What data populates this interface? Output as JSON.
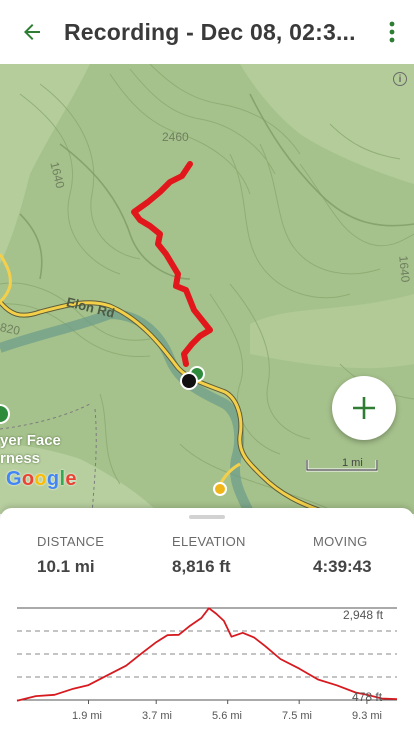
{
  "app_bar": {
    "title": "Recording - Dec 08, 02:3...",
    "back_icon": "arrow-back-icon",
    "menu_icon": "more-vertical-icon",
    "accent_color": "#2e7d32"
  },
  "map": {
    "contour_labels": [
      "2460",
      "1640",
      "1640",
      "820"
    ],
    "road_label": "Elon Rd",
    "place_label_line1": "yer Face",
    "place_label_line2": "rness",
    "google_logo": {
      "g": "G",
      "o1": "o",
      "o2": "o",
      "g2": "g",
      "l": "l",
      "e": "e"
    },
    "scale_label": "1 mi",
    "zoom_icon": "plus-icon",
    "info_icon": "info-icon",
    "route_color": "#e2171c"
  },
  "stats": {
    "distance": {
      "label": "DISTANCE",
      "value": "10.1 mi"
    },
    "elevation": {
      "label": "ELEVATION",
      "value": "8,816 ft"
    },
    "moving": {
      "label": "MOVING",
      "value": "4:39:43"
    }
  },
  "chart_data": {
    "type": "area",
    "title": "",
    "xlabel": "",
    "ylabel": "",
    "x_ticks": [
      "1.9 mi",
      "3.7 mi",
      "5.6 mi",
      "7.5 mi",
      "9.3 mi"
    ],
    "y_ticks": [
      "2,948 ft",
      "478 ft"
    ],
    "xlim": [
      0,
      10.1
    ],
    "ylim": [
      478,
      2948
    ],
    "grid": true,
    "series": [
      {
        "color": "#d61a1f",
        "x": [
          0,
          0.5,
          1.0,
          1.5,
          1.9,
          2.4,
          2.9,
          3.3,
          3.7,
          4.0,
          4.3,
          4.6,
          4.9,
          5.1,
          5.3,
          5.5,
          5.7,
          6.0,
          6.3,
          6.6,
          7.0,
          7.5,
          8.0,
          8.5,
          9.0,
          9.3,
          9.7,
          10.1
        ],
        "y": [
          480,
          560,
          640,
          760,
          900,
          1120,
          1420,
          1700,
          2050,
          2200,
          2250,
          2450,
          2700,
          2920,
          2810,
          2580,
          2200,
          2260,
          2180,
          1900,
          1600,
          1300,
          1050,
          850,
          700,
          600,
          540,
          480
        ]
      }
    ]
  }
}
